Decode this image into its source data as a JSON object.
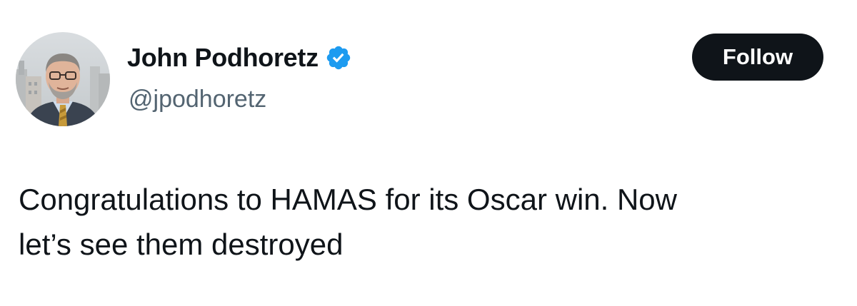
{
  "author": {
    "display_name": "John Podhoretz",
    "handle": "@jpodhoretz",
    "verified": true,
    "avatar_icon": "profile-photo"
  },
  "actions": {
    "follow_label": "Follow"
  },
  "tweet": {
    "text_line_1": "Congratulations to HAMAS for its Oscar win. Now",
    "text_line_2": "let’s see them destroyed"
  },
  "colors": {
    "text_primary": "#0f1419",
    "text_secondary": "#536471",
    "verified_blue": "#1d9bf0",
    "button_bg": "#0f1419",
    "button_text": "#ffffff",
    "background": "#ffffff"
  }
}
